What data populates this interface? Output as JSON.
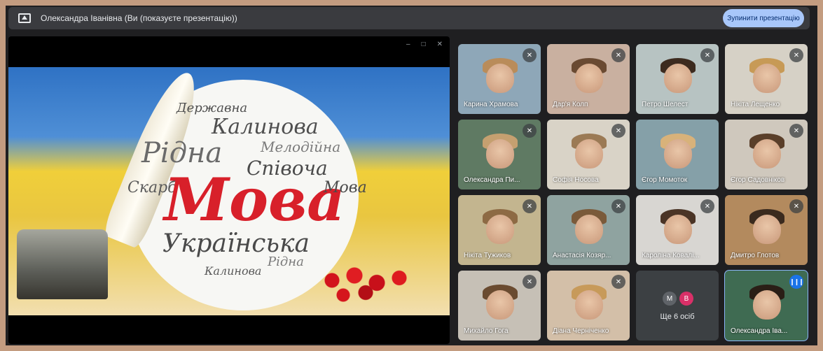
{
  "banner": {
    "text": "Олександра Іванівна (Ви (показуєте презентацію))",
    "stop_button": "Зупинити презентацію"
  },
  "presentation": {
    "window_controls": [
      "–",
      "□",
      "✕"
    ],
    "slide_words": {
      "main": "Мова",
      "ukrainska": "Українська",
      "kalynova": "Калинова",
      "derzhavna": "Державна",
      "ridna": "Рідна",
      "spivocha": "Співоча",
      "melodiina": "Мелодійна",
      "skarb": "Скарб",
      "kalynova2": "Калинова",
      "ridna2": "Рідна",
      "mova2": "Мова"
    }
  },
  "participants": [
    {
      "name": "Карина Храмова",
      "muted": true,
      "bg": "#8ea7b8",
      "hair": "#b98c5a"
    },
    {
      "name": "Дар'я Колп",
      "muted": true,
      "bg": "#c9b0a0",
      "hair": "#6a4a32"
    },
    {
      "name": "Петро Шелест",
      "muted": true,
      "bg": "#b7c3c2",
      "hair": "#3d2b1f"
    },
    {
      "name": "Нікіта Лещенко",
      "muted": true,
      "bg": "#d6d1c6",
      "hair": "#c79a56"
    },
    {
      "name": "Олександра Пи...",
      "muted": true,
      "bg": "#5f7a63",
      "hair": "#c5a070"
    },
    {
      "name": "Софія Носова",
      "muted": true,
      "bg": "#d9d3c7",
      "hair": "#9b7a55"
    },
    {
      "name": "Єгор Момоток",
      "muted": false,
      "bg": "#85a0a8",
      "hair": "#d8b27a"
    },
    {
      "name": "Єгор Садовніков",
      "muted": true,
      "bg": "#cfc8bd",
      "hair": "#5a3f2a"
    },
    {
      "name": "Нікіта Тужиков",
      "muted": true,
      "bg": "#c3b58f",
      "hair": "#8d6a44"
    },
    {
      "name": "Анастасія Козяр...",
      "muted": true,
      "bg": "#8fa3a0",
      "hair": "#7a5a3a"
    },
    {
      "name": "Кароліна Ковалі...",
      "muted": true,
      "bg": "#d8d6d2",
      "hair": "#4a3426"
    },
    {
      "name": "Дмитро Глотов",
      "muted": true,
      "bg": "#b38a5e",
      "hair": "#3a2a1e"
    },
    {
      "name": "Михайло Гога",
      "muted": true,
      "bg": "#c6c0b6",
      "hair": "#6a4b30"
    },
    {
      "name": "Діана Черніченко",
      "muted": true,
      "bg": "#d3bfa8",
      "hair": "#c79a5a"
    }
  ],
  "more": {
    "label": "Ще 6 осіб",
    "avatars": [
      {
        "letter": "М",
        "color": "#5f6368"
      },
      {
        "letter": "В",
        "color": "#d93068"
      }
    ]
  },
  "self_tile": {
    "name": "Олександра Іва...",
    "bg": "#3f6b52",
    "hair": "#2a1e16"
  },
  "icons": {
    "mic_off": "mic-off-icon",
    "speaking": "speaking-icon",
    "present": "present-icon"
  }
}
